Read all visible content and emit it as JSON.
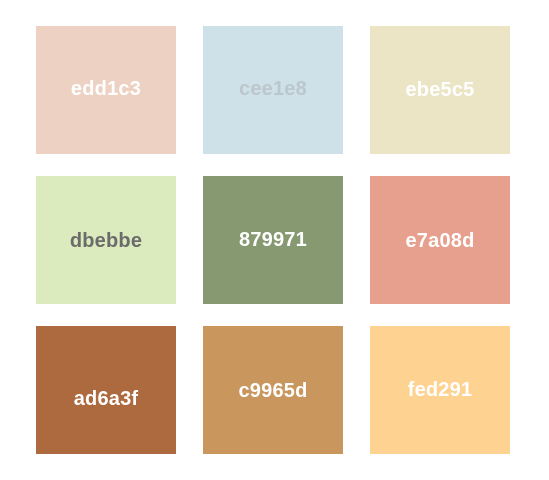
{
  "swatches": [
    {
      "label": "edd1c3",
      "background": "#edd1c3",
      "text_color": "#ffffff"
    },
    {
      "label": "cee1e8",
      "background": "#cee1e8",
      "text_color": "#bcc7cc"
    },
    {
      "label": "ebe5c5",
      "background": "#ebe5c5",
      "text_color": "#ffffff"
    },
    {
      "label": "dbebbe",
      "background": "#dbebbe",
      "text_color": "#6b6b6b"
    },
    {
      "label": "879971",
      "background": "#879971",
      "text_color": "#ffffff"
    },
    {
      "label": "e7a08d",
      "background": "#e7a08d",
      "text_color": "#ffffff"
    },
    {
      "label": "ad6a3f",
      "background": "#ad6a3f",
      "text_color": "#ffffff"
    },
    {
      "label": "c9965d",
      "background": "#c9965d",
      "text_color": "#ffffff"
    },
    {
      "label": "fed291",
      "background": "#fed291",
      "text_color": "#ffffff"
    }
  ]
}
